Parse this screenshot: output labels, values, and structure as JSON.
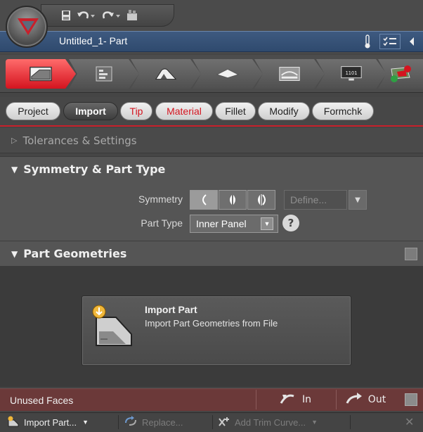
{
  "window": {
    "title": "Untitled_1- Part"
  },
  "quick_access": {
    "items": [
      {
        "icon": "save-icon"
      },
      {
        "icon": "undo-icon"
      },
      {
        "icon": "redo-icon"
      },
      {
        "icon": "customize-icon"
      }
    ]
  },
  "title_bar_right": [
    {
      "icon": "thermometer-icon"
    },
    {
      "icon": "checklist-icon"
    },
    {
      "icon": "collapse-left-icon"
    }
  ],
  "stages": [
    {
      "name": "part-setup",
      "icon": "part-setup-icon",
      "active": true
    },
    {
      "name": "blank",
      "icon": "blank-icon",
      "active": false
    },
    {
      "name": "die-face",
      "icon": "die-face-icon",
      "active": false
    },
    {
      "name": "binder",
      "icon": "binder-icon",
      "active": false
    },
    {
      "name": "addendum",
      "icon": "addendum-icon",
      "active": false
    },
    {
      "name": "simulation",
      "icon": "simulation-icon",
      "active": false
    },
    {
      "name": "results",
      "icon": "results-icon",
      "active": false
    }
  ],
  "stage_labels": {
    "simulation_text": "1101"
  },
  "tabs": [
    {
      "label": "Project",
      "style": "normal"
    },
    {
      "label": "Import",
      "style": "active"
    },
    {
      "label": "Tip",
      "style": "red"
    },
    {
      "label": "Material",
      "style": "red"
    },
    {
      "label": "Fillet",
      "style": "normal"
    },
    {
      "label": "Modify",
      "style": "normal"
    },
    {
      "label": "Formchk",
      "style": "normal"
    }
  ],
  "sections": {
    "tolerances": {
      "label": "Tolerances & Settings",
      "expanded": false
    },
    "symmetry": {
      "label": "Symmetry & Part Type",
      "expanded": true,
      "symmetry_label": "Symmetry",
      "define_placeholder": "Define...",
      "part_type_label": "Part Type",
      "part_type_value": "Inner Panel",
      "help_label": "?"
    },
    "geometries": {
      "label": "Part Geometries",
      "expanded": true,
      "import_title": "Import Part",
      "import_desc": "Import Part Geometries from File"
    }
  },
  "unused_faces": {
    "label": "Unused Faces",
    "in_label": "In",
    "out_label": "Out"
  },
  "bottom_toolbar": {
    "import_part": "Import Part...",
    "replace": "Replace...",
    "add_trim_curve": "Add Trim Curve..."
  },
  "colors": {
    "accent": "#d4141f",
    "title_bar": "#3e5a80",
    "unused_bar": "#6b3939"
  }
}
